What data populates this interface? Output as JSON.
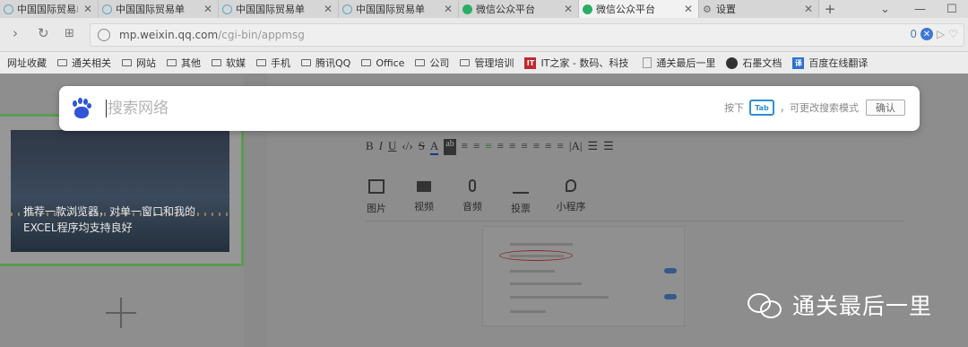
{
  "tabs": [
    {
      "label": "中国国际贸易单",
      "icon": "globe-icon"
    },
    {
      "label": "中国国际贸易单",
      "icon": "globe-icon"
    },
    {
      "label": "中国国际贸易单",
      "icon": "globe-icon"
    },
    {
      "label": "中国国际贸易单",
      "icon": "globe-icon"
    },
    {
      "label": "微信公众平台",
      "icon": "wechat-icon"
    },
    {
      "label": "微信公众平台",
      "icon": "wechat-icon",
      "active": true
    },
    {
      "label": "设置",
      "icon": "gear-icon"
    }
  ],
  "address": {
    "url_domain": "mp.weixin.qq.com",
    "url_path": "/cgi-bin/appmsg",
    "badge_count": "0"
  },
  "bookmarks": [
    {
      "label": "网址收藏",
      "icon": "none"
    },
    {
      "label": "通关相关",
      "icon": "folder-icon"
    },
    {
      "label": "网站",
      "icon": "folder-icon"
    },
    {
      "label": "其他",
      "icon": "folder-icon"
    },
    {
      "label": "软媒",
      "icon": "folder-icon"
    },
    {
      "label": "手机",
      "icon": "folder-icon"
    },
    {
      "label": "腾讯QQ",
      "icon": "folder-icon"
    },
    {
      "label": "Office",
      "icon": "folder-icon"
    },
    {
      "label": "公司",
      "icon": "folder-icon"
    },
    {
      "label": "管理培训",
      "icon": "folder-icon"
    },
    {
      "label": "IT之家 - 数码、科技",
      "icon": "ithome-icon",
      "badge": "IT"
    },
    {
      "label": "通关最后一里",
      "icon": "page-icon"
    },
    {
      "label": "石墨文档",
      "icon": "shimo-icon"
    },
    {
      "label": "百度在线翻译",
      "icon": "translate-icon",
      "badge": "译"
    }
  ],
  "article": {
    "caption": "推荐一款浏览器，对单一窗口和我的EXCEL程序均支持良好"
  },
  "editor": {
    "format_tools": [
      "B",
      "I",
      "U",
      "‹/›",
      "S",
      "A",
      "ab",
      "≡",
      "≡",
      "≡",
      "≡",
      "≡",
      "≡",
      "≡",
      "≡",
      "≡",
      "|A|",
      "☰",
      "☰"
    ],
    "insert_items": [
      {
        "label": "图片",
        "icon": "image-icon"
      },
      {
        "label": "视频",
        "icon": "video-icon"
      },
      {
        "label": "音频",
        "icon": "audio-icon"
      },
      {
        "label": "投票",
        "icon": "vote-icon"
      },
      {
        "label": "小程序",
        "icon": "miniprogram-icon"
      }
    ]
  },
  "watermark": {
    "text": "通关最后一里"
  },
  "search": {
    "placeholder": "搜索网络",
    "hint_prefix": "按下",
    "tab_key": "Tab",
    "hint_suffix": "，可更改搜索模式",
    "confirm_label": "确认"
  }
}
